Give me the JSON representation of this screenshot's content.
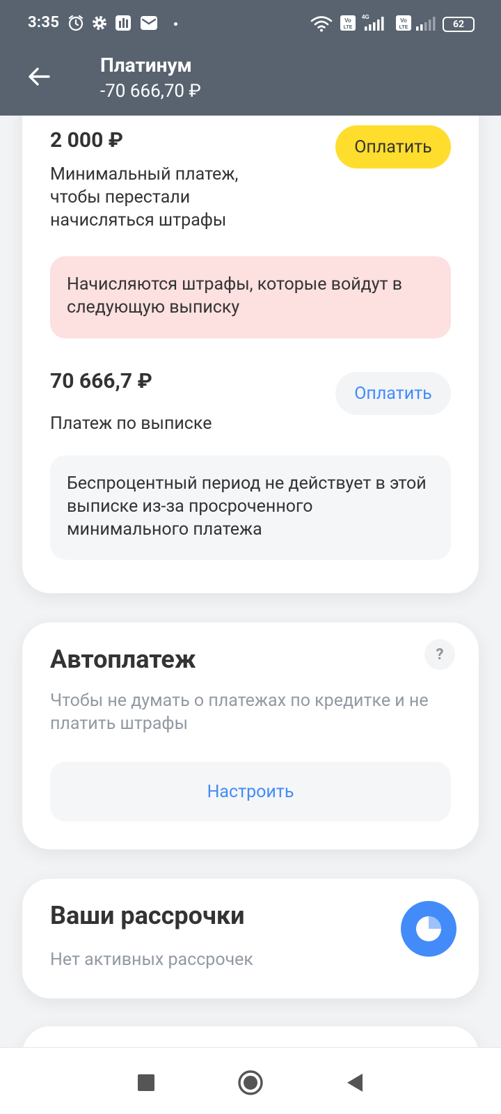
{
  "status_bar": {
    "time": "3:35",
    "battery": "62",
    "icons": [
      "alarm-icon",
      "gear-icon",
      "app-icon",
      "mail-icon",
      "wifi-icon",
      "volte-icon",
      "signal-icon",
      "volte-icon",
      "signal-icon",
      "battery-icon"
    ]
  },
  "header": {
    "title": "Платинум",
    "balance": "-70 666,70 ₽"
  },
  "payments": {
    "minimum": {
      "amount": "2 000 ₽",
      "description": "Минимальный платеж, чтобы перестали начисляться штрафы",
      "pay_label": "Оплатить"
    },
    "penalty_alert": "Начисляются штрафы, которые войдут в следующую выписку",
    "statement": {
      "amount": "70 666,7 ₽",
      "description": "Платеж по выписке",
      "pay_label": "Оплатить"
    },
    "grace_notice": "Беспроцентный период не действует в этой выписке из-за просроченного минимального платежа"
  },
  "autopay": {
    "title": "Автоплатеж",
    "subtitle": "Чтобы не думать о платежах по кредитке и не платить штрафы",
    "help_label": "?",
    "setup_label": "Настроить"
  },
  "installments": {
    "title": "Ваши рассрочки",
    "subtitle": "Нет активных рассрочек"
  },
  "colors": {
    "header_bg": "#58636f",
    "accent_yellow": "#ffdd2d",
    "link_blue": "#428bf9",
    "alert_pink": "#fde0e0"
  }
}
